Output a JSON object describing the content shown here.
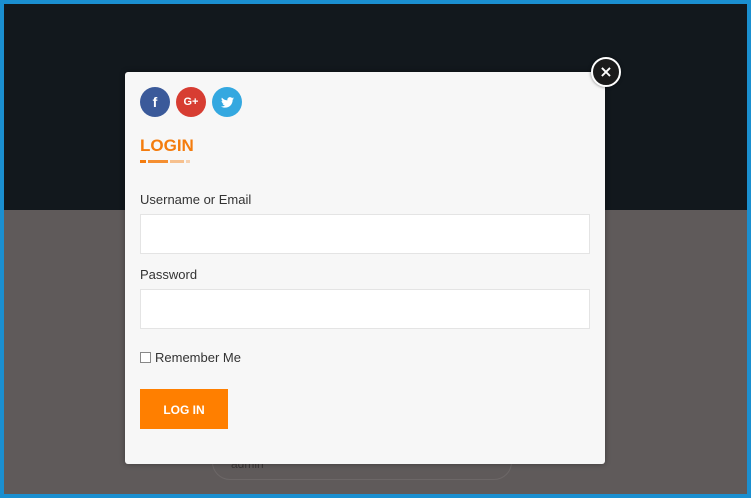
{
  "background": {
    "field_text": "admin"
  },
  "modal": {
    "close_label": "×",
    "social": {
      "facebook_label": "f",
      "google_label": "G+",
      "twitter_label": "t"
    },
    "title": "LOGIN",
    "username_label": "Username or Email",
    "username_value": "",
    "password_label": "Password",
    "password_value": "",
    "remember_label": "Remember Me",
    "remember_checked": false,
    "submit_label": "LOG IN"
  },
  "colors": {
    "accent": "#f47c0e",
    "button": "#ff7f00",
    "frame_border": "#1a8fd0",
    "facebook": "#3b5a9a",
    "google": "#d73d32",
    "twitter": "#34a8e0"
  }
}
